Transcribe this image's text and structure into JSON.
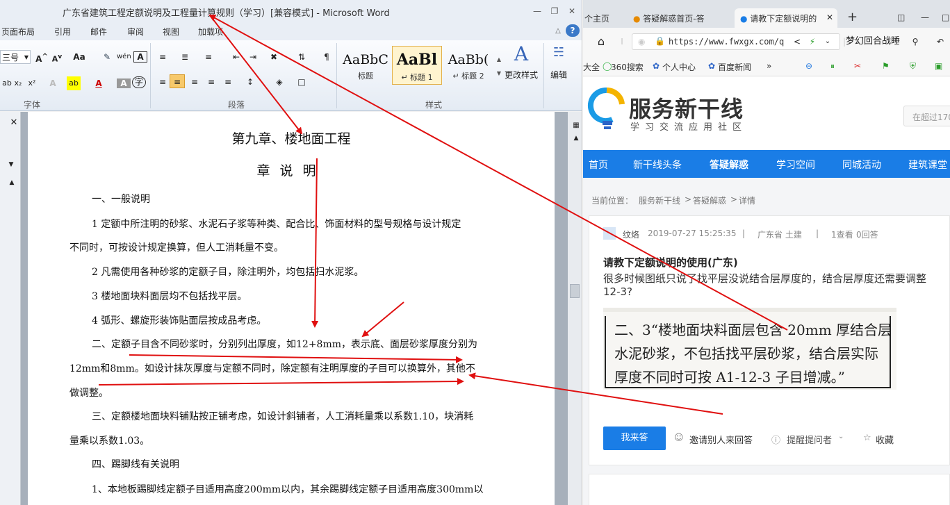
{
  "word": {
    "title": "广东省建筑工程定额说明及工程量计算规则（学习）[兼容模式] - Microsoft Word",
    "tabs": [
      "页面布局",
      "引用",
      "邮件",
      "审阅",
      "视图",
      "加载项"
    ],
    "font_size": "三号",
    "style_gallery": [
      {
        "sample": "AaBbC",
        "name": "标题"
      },
      {
        "sample": "AaBl",
        "name": "↵ 标题 1"
      },
      {
        "sample": "AaBb(",
        "name": "↵ 标题 2"
      }
    ],
    "change_styles_label": "更改样式",
    "edit_label": "编辑",
    "group_labels": {
      "font": "字体",
      "paragraph": "段落",
      "styles": "样式"
    },
    "doc": {
      "heading": "第九章、楼地面工程",
      "subheading": "章说明",
      "lines": [
        "一、一般说明",
        "1  定额中所注明的砂浆、水泥石子浆等种类、配合比、饰面材料的型号规格与设计规定",
        "不同时，可按设计规定换算，但人工消耗量不变。",
        "2  凡需使用各种砂浆的定额子目，除注明外，均包括扫水泥浆。",
        "3  楼地面块料面层均不包括找平层。",
        "4  弧形、螺旋形装饰贴面层按成品考虑。",
        "二、定额子目含不同砂浆时，分别列出厚度，如12+8mm，表示底、面层砂浆厚度分别为",
        "12mm和8mm。如设计抹灰厚度与定额不同时，除定额有注明厚度的子目可以换算外，其他不",
        "做调整。",
        "三、定额楼地面块料铺贴按正铺考虑，如设计斜铺者，人工消耗量乘以系数1.10，块消耗",
        "量乘以系数1.03。",
        "四、踢脚线有关说明",
        "1、本地板踢脚线定额子目适用高度200mm以内，其余踢脚线定额子目适用高度300mm以"
      ]
    }
  },
  "browser": {
    "tabs": [
      "个主页",
      "答疑解惑首页-答",
      "请教下定额说明的"
    ],
    "url": "https://www.fwxgx.com/q",
    "right_text": "梦幻回合战睡",
    "bookmarks": [
      "大全",
      "360搜索",
      "个人中心",
      "百度新闻"
    ],
    "site": {
      "logo_title": "服务新干线",
      "logo_sub": "学习交流应用社区",
      "search_placeholder": "在超过170",
      "nav": [
        "首页",
        "新干线头条",
        "答疑解惑",
        "学习空间",
        "同城活动",
        "建筑课堂"
      ],
      "breadcrumb": [
        "当前位置：",
        "服务新干线",
        ">",
        "答疑解惑",
        ">",
        "详情"
      ],
      "question": {
        "user": "纹烙",
        "time": "2019-07-27 15:25:35",
        "region": "广东省  土建",
        "views": "1查看",
        "answers": "0回答",
        "title": "请教下定额说明的使用(广东)",
        "body1": "很多时候图纸只说了找平层没说结合层厚度的，结合层厚度还需要调整",
        "body2": "12-3?",
        "image_lines": [
          "二、3“楼地面块料面层包含 20mm 厚结合层",
          "水泥砂浆，不包括找平层砂浆，结合层实际",
          "厚度不同时可按 A1-12-3 子目增减。”"
        ],
        "answer_button": "我来答",
        "actions": [
          "邀请别人来回答",
          "提醒提问者",
          "收藏"
        ]
      }
    }
  },
  "colors": {
    "arrow": "#e01010",
    "site_blue": "#1a7de6"
  }
}
